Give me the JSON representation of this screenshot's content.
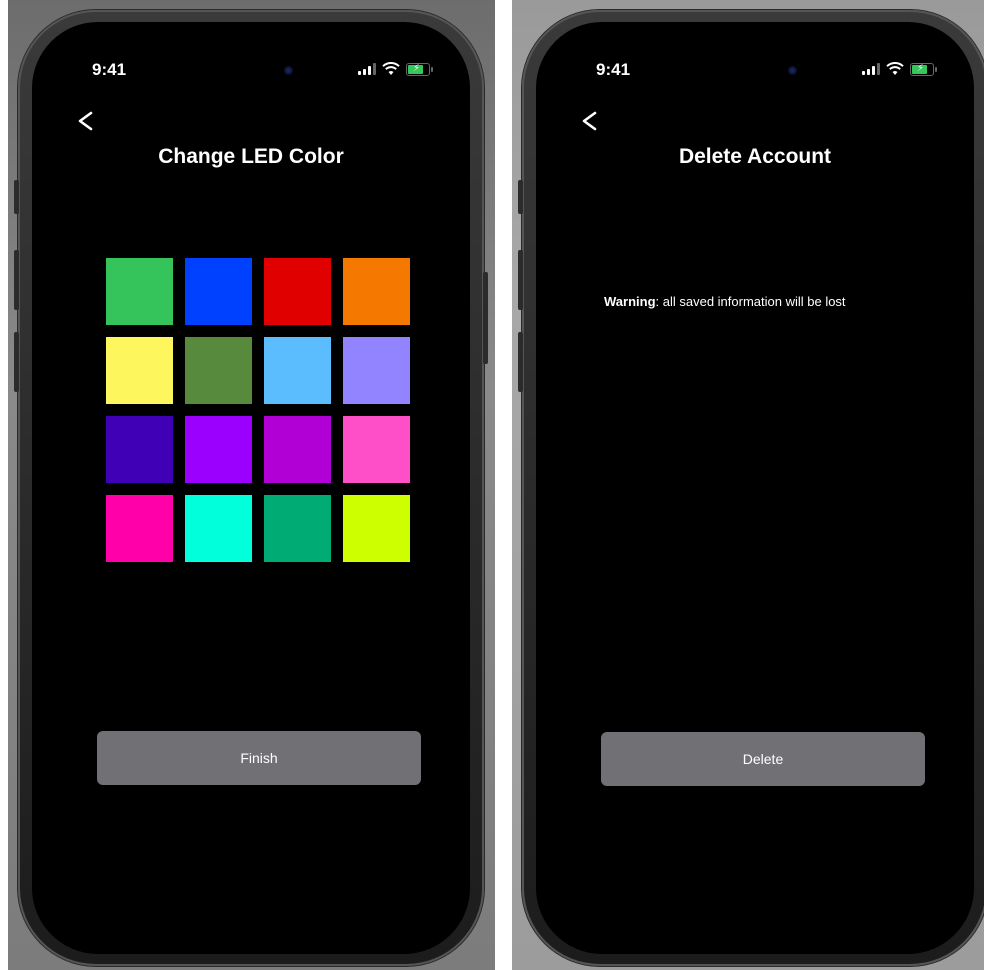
{
  "screens": [
    {
      "time": "9:41",
      "title": "Change LED Color",
      "button_label": "Finish",
      "swatches": [
        {
          "name": "green",
          "color": "#35c45b"
        },
        {
          "name": "blue",
          "color": "#0040ff"
        },
        {
          "name": "red",
          "color": "#e00000"
        },
        {
          "name": "orange",
          "color": "#f57800"
        },
        {
          "name": "yellow",
          "color": "#fdf65d"
        },
        {
          "name": "olive-green",
          "color": "#578a3c"
        },
        {
          "name": "light-blue",
          "color": "#5bbdfd"
        },
        {
          "name": "lavender",
          "color": "#9283ff"
        },
        {
          "name": "indigo",
          "color": "#4000b5"
        },
        {
          "name": "violet",
          "color": "#9b00ff"
        },
        {
          "name": "purple",
          "color": "#b000d6"
        },
        {
          "name": "pink",
          "color": "#ff4fc8"
        },
        {
          "name": "magenta",
          "color": "#ff00a9"
        },
        {
          "name": "aqua",
          "color": "#00ffda"
        },
        {
          "name": "teal-green",
          "color": "#00ab74"
        },
        {
          "name": "lime",
          "color": "#ceff00"
        }
      ]
    },
    {
      "time": "9:41",
      "title": "Delete Account",
      "warning_bold": "Warning",
      "warning_text": ": all saved information will be lost",
      "button_label": "Delete"
    }
  ],
  "colors": {
    "screen_background": "#000000",
    "button_background": "#717175",
    "battery_green": "#34c759"
  }
}
